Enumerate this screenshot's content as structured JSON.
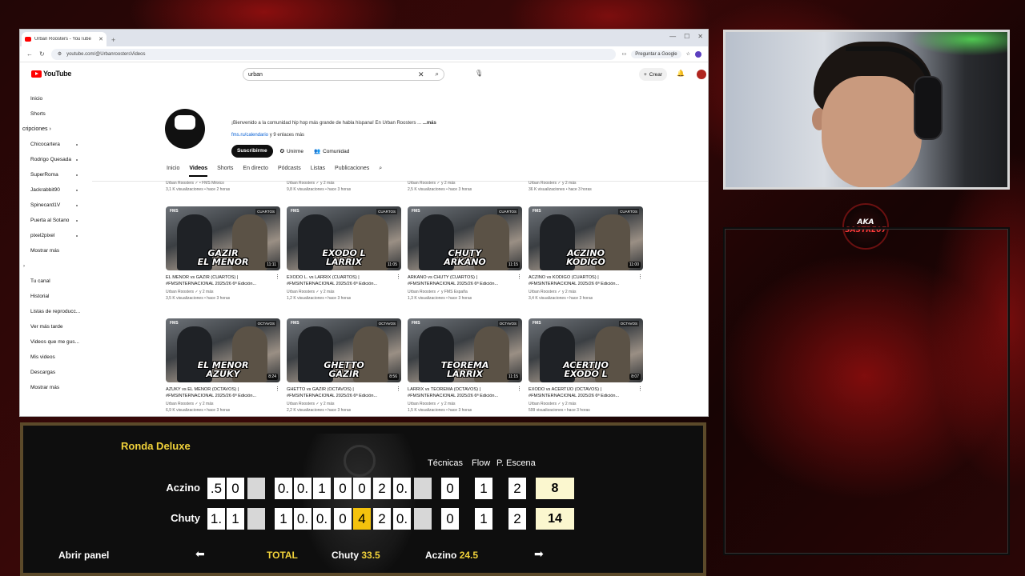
{
  "browser": {
    "tab_title": "Urban Roosters - YouTube",
    "url": "youtube.com/@UrbanroostersVideos",
    "ask_google": "Preguntar a Google"
  },
  "youtube": {
    "logo": "YouTube",
    "search_value": "urban",
    "create_label": "Crear",
    "sidebar": {
      "home": "Inicio",
      "shorts": "Shorts",
      "subs_header": "cripciones",
      "subscriptions": [
        "Chicocartera",
        "Rodrigo Quesada",
        "SuperRoma",
        "Jackrabbit90",
        "Spinecard1V",
        "Puerta al Sotano",
        "pixel2pixel"
      ],
      "show_more": "Mostrar más",
      "you": [
        "Tu canal",
        "Historial",
        "Listas de reproducc...",
        "Ver más tarde",
        "Videos que me gus...",
        "Mis videos",
        "Descargas"
      ],
      "show_more2": "Mostrar más"
    },
    "channel": {
      "description": "¡Bienvenido a la comunidad hip hop más grande de habla hispana! En Urban Roosters ...",
      "more": "...más",
      "links": "fms.ru/calendario",
      "links_more": "y 9 enlaces más",
      "subscribe": "Suscribirme",
      "join": "Unirme",
      "community": "Comunidad",
      "tabs": [
        "Inicio",
        "Videos",
        "Shorts",
        "En directo",
        "Pódcasts",
        "Listas",
        "Publicaciones"
      ]
    },
    "top_meta": [
      {
        "channel": "Urban Roosters ✓ • FMS México",
        "stats": "3,1 K visualizaciones • hace 2 horas"
      },
      {
        "channel": "Urban Roosters ✓ y 2 más",
        "stats": "9,8 K visualizaciones • hace 3 horas"
      },
      {
        "channel": "Urban Roosters ✓ y 2 más",
        "stats": "2,5 K visualizaciones • hace 3 horas"
      },
      {
        "channel": "Urban Roosters ✓ y 2 más",
        "stats": "36 K visualizaciones • hace 3 horas"
      }
    ],
    "videos_row1": [
      {
        "overlay1": "GAZIR",
        "overlay2": "EL MENOR",
        "duration": "11:11",
        "round": "CUARTOS",
        "title": "EL MENOR vs GAZIR (CUARTOS) | #FMSINTERNACIONAL 2025/26 6ª Edición...",
        "channel": "Urban Roosters ✓ y 2 más",
        "stats": "3,5 K visualizaciones • hace 3 horas"
      },
      {
        "overlay1": "EXODO L",
        "overlay2": "LARRIX",
        "duration": "11:05",
        "round": "CUARTOS",
        "title": "EXODO L. vs LARRIX (CUARTOS) | #FMSINTERNACIONAL 2025/26 6ª Edición...",
        "channel": "Urban Roosters ✓ y 2 más",
        "stats": "1,2 K visualizaciones • hace 3 horas"
      },
      {
        "overlay1": "CHUTY",
        "overlay2": "ARKANO",
        "duration": "11:15",
        "round": "CUARTOS",
        "title": "ARKANO vs CHUTY (CUARTOS) | #FMSINTERNACIONAL 2025/26 6ª Edición...",
        "channel": "Urban Roosters ✓ y FMS España",
        "stats": "1,3 K visualizaciones • hace 3 horas"
      },
      {
        "overlay1": "ACZINO",
        "overlay2": "KODIGO",
        "duration": "11:00",
        "round": "CUARTOS",
        "title": "ACZINO vs KODIGO (CUARTOS) | #FMSINTERNACIONAL 2025/26 6ª Edición...",
        "channel": "Urban Roosters ✓ y 2 más",
        "stats": "3,4 K visualizaciones • hace 3 horas"
      }
    ],
    "videos_row2": [
      {
        "overlay1": "EL MENOR",
        "overlay2": "AZUKY",
        "duration": "8:24",
        "round": "OCTAVOS",
        "title": "AZUKY vs EL MENOR (OCTAVOS) | #FMSINTERNACIONAL 2025/26 6ª Edición...",
        "channel": "Urban Roosters ✓ y 2 más",
        "stats": "6,9 K visualizaciones • hace 3 horas"
      },
      {
        "overlay1": "GHETTO",
        "overlay2": "GAZIR",
        "duration": "8:56",
        "round": "OCTAVOS",
        "title": "GHETTO vs GAZIR (OCTAVOS) | #FMSINTERNACIONAL 2025/26 6ª Edición...",
        "channel": "Urban Roosters ✓ y 2 más",
        "stats": "2,2 K visualizaciones • hace 3 horas"
      },
      {
        "overlay1": "TEOREMA",
        "overlay2": "LARRIX",
        "duration": "11:15",
        "round": "OCTAVOS",
        "title": "LARRIX vs TEOREMA (OCTAVOS) | #FMSINTERNACIONAL 2025/26 6ª Edición...",
        "channel": "Urban Roosters ✓ y 2 más",
        "stats": "1,5 K visualizaciones • hace 3 horas"
      },
      {
        "overlay1": "ACERTIJO",
        "overlay2": "EXODO L",
        "duration": "8:07",
        "round": "OCTAVOS",
        "title": "EXODO vs ACERTIJO (OCTAVOS) | #FMSINTERNACIONAL 2025/26 6ª Edición...",
        "channel": "Urban Roosters ✓ y 2 más",
        "stats": "599 visualizaciones • hace 3 horas"
      }
    ]
  },
  "badge": {
    "line1": "AKA",
    "line2": "SASTRE07"
  },
  "score_panel": {
    "title": "Ronda Deluxe",
    "headers": [
      "Técnicas",
      "Flow",
      "P. Escena"
    ],
    "rows": [
      {
        "name": "Aczino",
        "cells": [
          ".5",
          "0",
          "",
          "0.",
          "0.",
          "1",
          "0",
          "0",
          "2",
          "0.",
          ""
        ],
        "tecnicas": "0",
        "flow": "1",
        "escena": "2",
        "total": "8",
        "highlight": -1
      },
      {
        "name": "Chuty",
        "cells": [
          "1.",
          "1",
          "",
          "1",
          "0.",
          "0.",
          "0",
          "4",
          "2",
          "0.",
          ""
        ],
        "tecnicas": "0",
        "flow": "1",
        "escena": "2",
        "total": "14",
        "highlight": 7
      }
    ],
    "open_panel": "Abrir panel",
    "total_label": "TOTAL",
    "totals": [
      {
        "name": "Chuty",
        "score": "33.5"
      },
      {
        "name": "Aczino",
        "score": "24.5"
      }
    ],
    "arrow_left": "⬅",
    "arrow_right": "➡"
  }
}
